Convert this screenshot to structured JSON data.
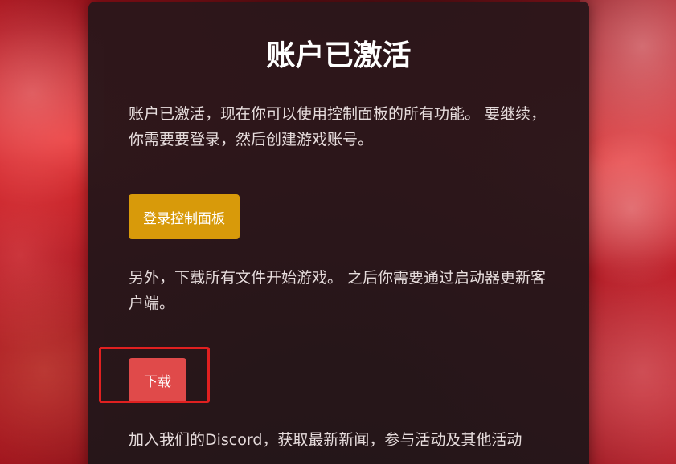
{
  "card": {
    "title": "账户已激活",
    "intro_text": "账户已激活，现在你可以使用控制面板的所有功能。 要继续，你需要要登录，然后创建游戏账号。",
    "login_button_label": "登录控制面板",
    "download_text": "另外，下载所有文件开始游戏。 之后你需要通过启动器更新客户端。",
    "download_button_label": "下载",
    "discord_text": "加入我们的Discord，获取最新新闻，参与活动及其他活动"
  },
  "colors": {
    "login_button": "#d89a0a",
    "download_button": "#e04a4a",
    "highlight_border": "#e02020"
  }
}
